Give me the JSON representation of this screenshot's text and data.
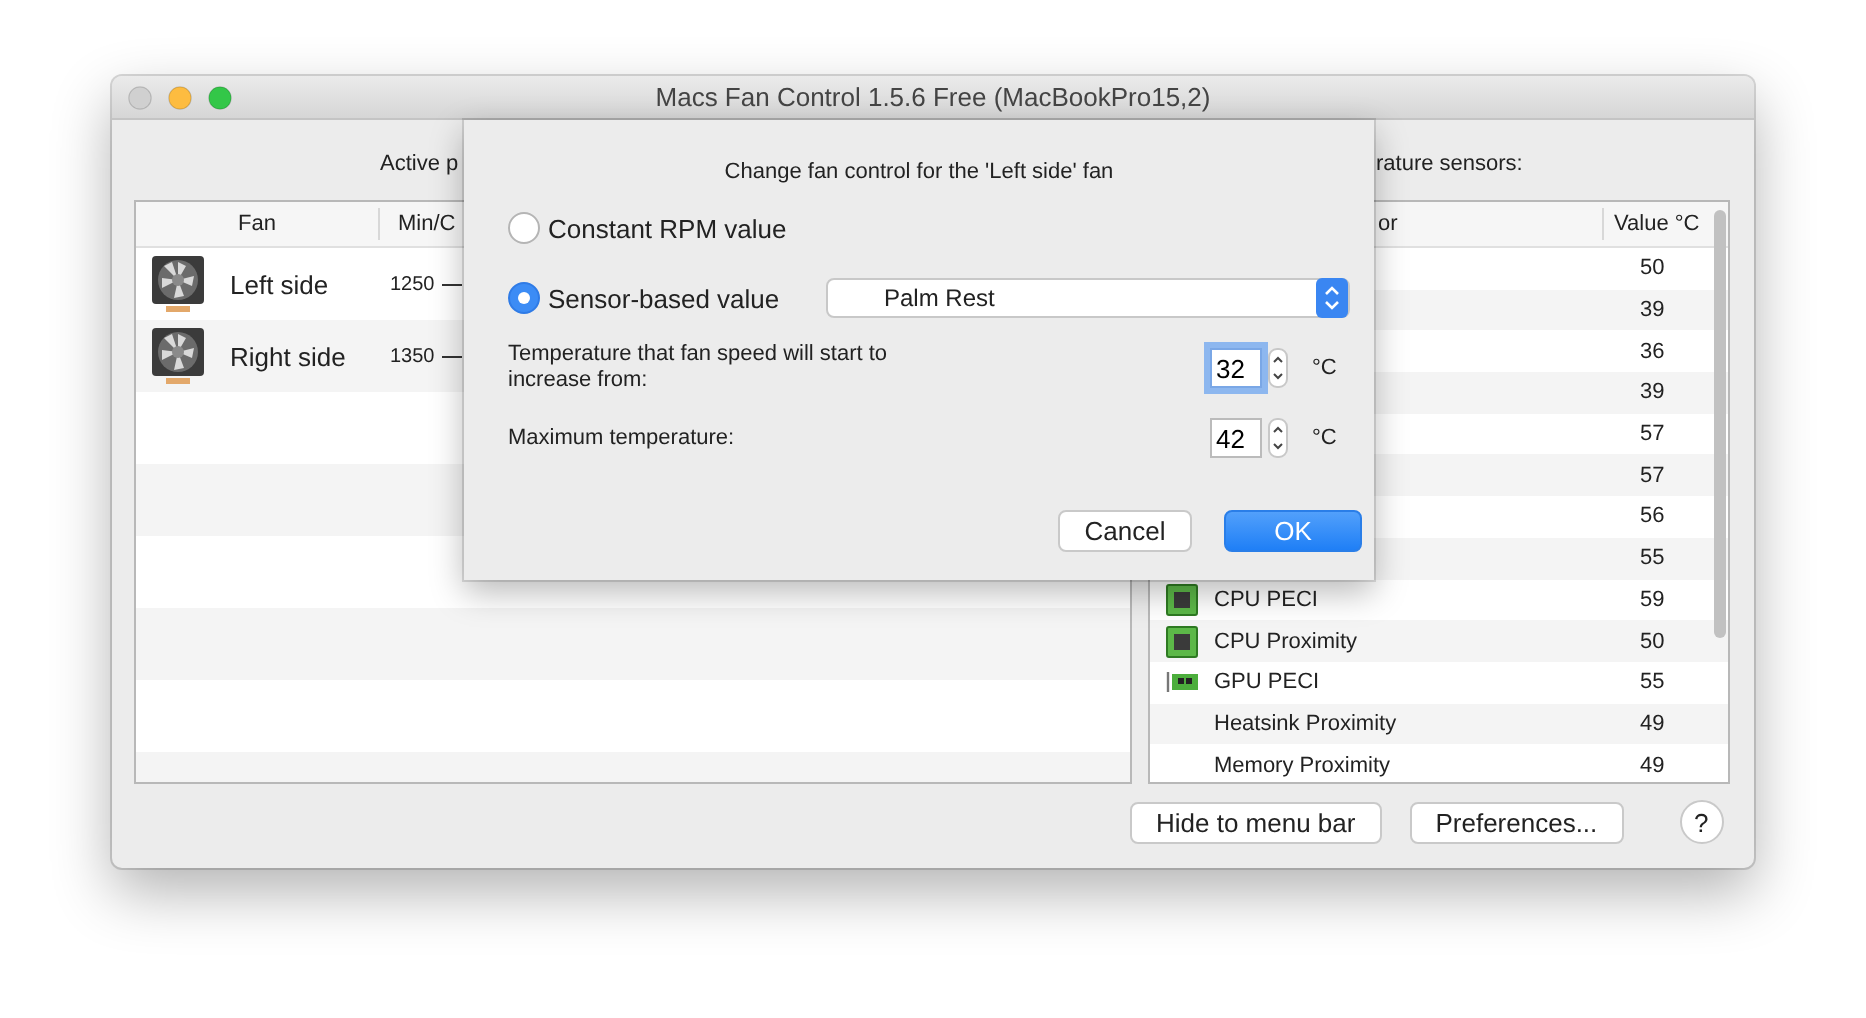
{
  "window": {
    "title": "Macs Fan Control 1.5.6 Free (MacBookPro15,2)"
  },
  "fans_panel": {
    "label": "Active p",
    "columns": [
      "Fan",
      "Min/C"
    ],
    "rows": [
      {
        "name": "Left side",
        "min": "1250"
      },
      {
        "name": "Right side",
        "min": "1350"
      }
    ]
  },
  "sensors_panel": {
    "label": "rature sensors:",
    "columns": [
      "or",
      "Value °C"
    ],
    "rows": [
      {
        "value": "50"
      },
      {
        "value": "39"
      },
      {
        "value": "36"
      },
      {
        "value": "39"
      },
      {
        "value": "57"
      },
      {
        "value": "57"
      },
      {
        "value": "56"
      },
      {
        "value": "55"
      },
      {
        "name": "CPU PECI",
        "value": "59",
        "kind": "chip"
      },
      {
        "name": "CPU Proximity",
        "value": "50",
        "kind": "chip"
      },
      {
        "name": "GPU PECI",
        "value": "55",
        "kind": "gpu"
      },
      {
        "name": "Heatsink Proximity",
        "value": "49",
        "kind": "plain"
      },
      {
        "name": "Memory Proximity",
        "value": "49",
        "kind": "plain"
      }
    ]
  },
  "buttons": [
    "Hide to menu bar",
    "Preferences..."
  ],
  "help_button": "?",
  "dialog": {
    "title": "Change fan control for the 'Left side' fan",
    "options": [
      {
        "label": "Constant RPM value",
        "selected": false
      },
      {
        "label": "Sensor-based value",
        "selected": true
      }
    ],
    "sensor_popup": {
      "value": "Palm Rest"
    },
    "fields": [
      {
        "label": "Temperature that fan speed will start to increase from:",
        "value": "32",
        "unit": "°C",
        "focused": true
      },
      {
        "label": "Maximum temperature:",
        "value": "42",
        "unit": "°C",
        "focused": false
      }
    ],
    "buttons": [
      {
        "label": "Cancel",
        "default": false
      },
      {
        "label": "OK",
        "default": true
      }
    ]
  }
}
